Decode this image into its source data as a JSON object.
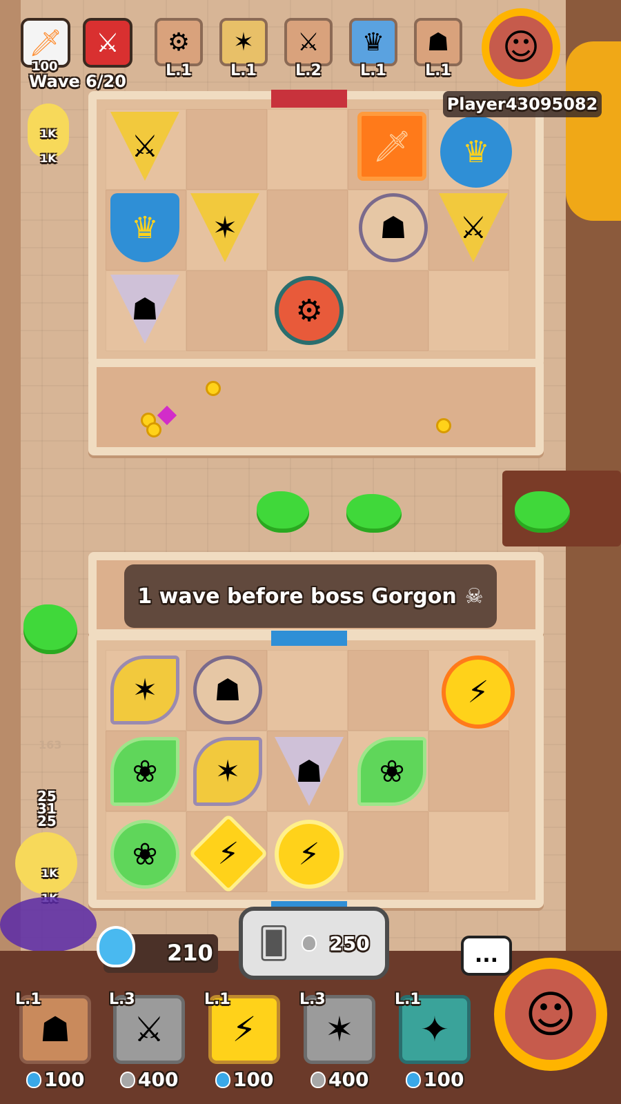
{
  "header": {
    "wave_count": "100",
    "wave_label": "Wave 6/20",
    "player_name": "Player43095082"
  },
  "top_deck": [
    {
      "level": "L.1",
      "icon": "tesla-unit-icon"
    },
    {
      "level": "L.1",
      "icon": "gunner-unit-icon"
    },
    {
      "level": "L.2",
      "icon": "knight-unit-icon"
    },
    {
      "level": "L.1",
      "icon": "banner-unit-icon"
    },
    {
      "level": "L.1",
      "icon": "rogue-unit-icon"
    }
  ],
  "side_stats": {
    "top_a": "1K",
    "top_b": "1K",
    "left_hp": "163",
    "stack_1": "25",
    "stack_2": "31",
    "stack_3": "25",
    "bottom_a": "1K",
    "bottom_b": "1K"
  },
  "wave_banner": {
    "text": "1 wave before boss Gorgon",
    "icon": "gorgon-skull-icon"
  },
  "mana": {
    "value": "210",
    "icon": "mana-flask-icon"
  },
  "summon": {
    "cost": "250",
    "icon": "summon-cards-icon"
  },
  "chat": {
    "label": "..."
  },
  "hand": [
    {
      "level": "L.1",
      "cost": "100",
      "icon": "rogue-unit-icon",
      "currency": "mana"
    },
    {
      "level": "L.3",
      "cost": "400",
      "icon": "knight-unit-icon",
      "currency": "silver"
    },
    {
      "level": "L.1",
      "cost": "100",
      "icon": "sorcerer-unit-icon",
      "currency": "mana"
    },
    {
      "level": "L.3",
      "cost": "400",
      "icon": "gunner-unit-icon",
      "currency": "silver"
    },
    {
      "level": "L.1",
      "cost": "100",
      "icon": "mage-unit-icon",
      "currency": "mana"
    }
  ],
  "colors": {
    "red_banner": "#c8323c",
    "blue_banner": "#2f8fd6",
    "gold": "#ffb400",
    "slime": "#40d83a"
  }
}
